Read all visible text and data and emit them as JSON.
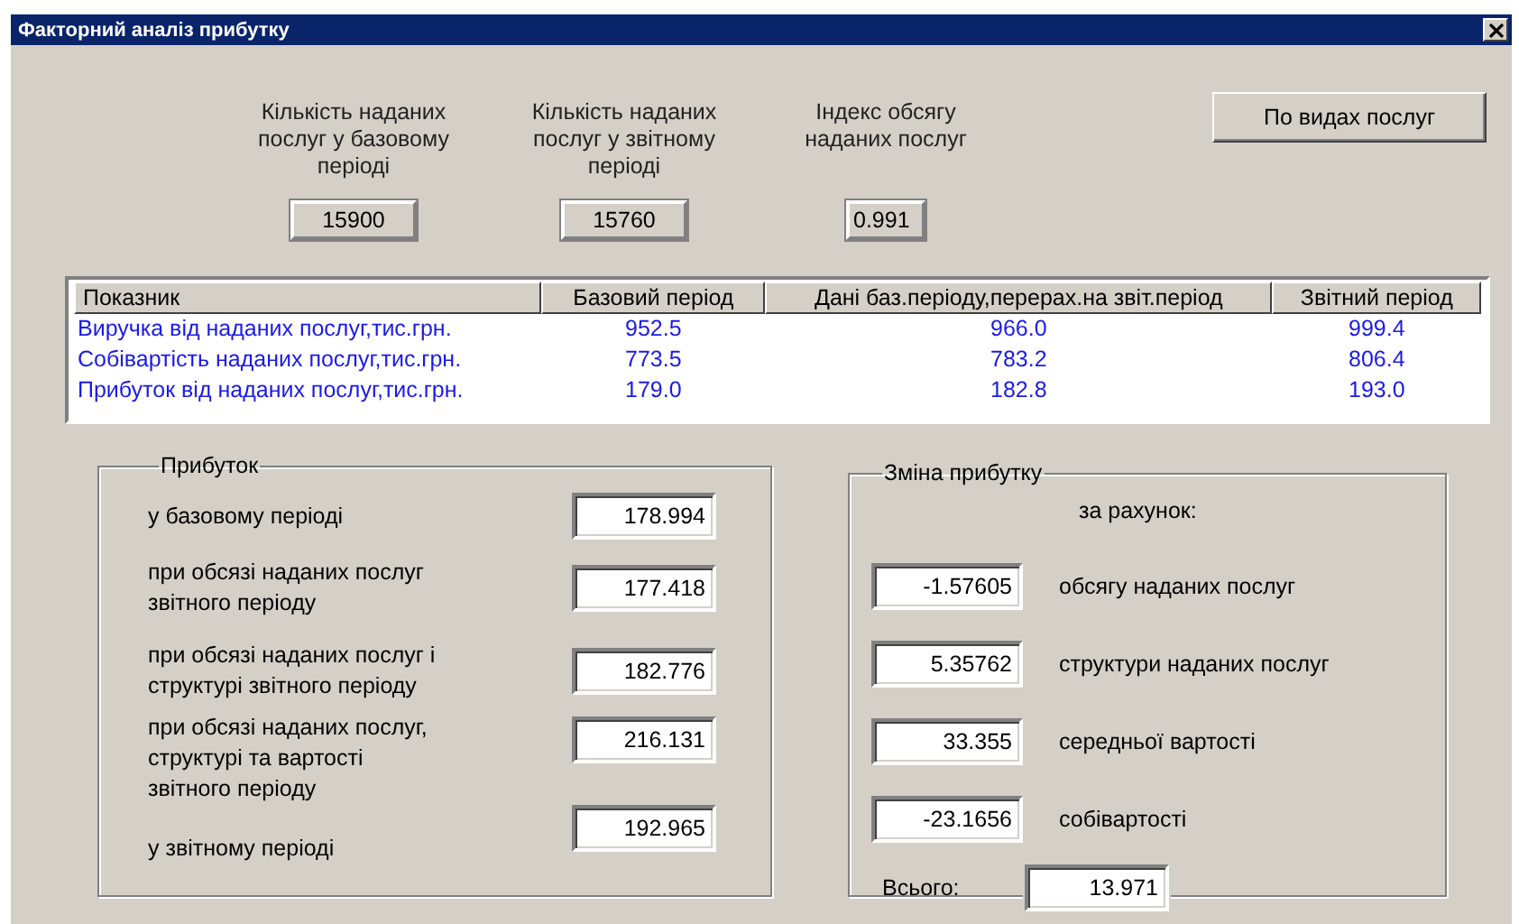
{
  "window": {
    "title": "Факторний аналіз прибутку"
  },
  "summary": [
    {
      "label": "Кількість наданих\nпослуг у базовому\nперіоді",
      "value": "15900"
    },
    {
      "label": "Кількість наданих\nпослуг у звітному\nперіоді",
      "value": "15760"
    },
    {
      "label": "Індекс обсягу\nнаданих послуг",
      "value": "0.991"
    }
  ],
  "button": "По видах послуг",
  "table": {
    "columns": [
      "Показник",
      "Базовий період",
      "Дані баз.періоду,перерах.на звіт.період",
      "Звітний період"
    ],
    "rows": [
      [
        "Виручка від наданих послуг,тис.грн.",
        "952.5",
        "966.0",
        "999.4"
      ],
      [
        "Собівартість наданих послуг,тис.грн.",
        "773.5",
        "783.2",
        "806.4"
      ],
      [
        "Прибуток від наданих послуг,тис.грн.",
        "179.0",
        "182.8",
        "193.0"
      ]
    ]
  },
  "profit": {
    "title": "Прибуток",
    "rows": [
      {
        "label": "у базовому періоді",
        "value": "178.994"
      },
      {
        "label": "при обсязі наданих послуг\nзвітного періоду",
        "value": "177.418"
      },
      {
        "label": "при обсязі наданих послуг і\nструктурі звітного періоду",
        "value": "182.776"
      },
      {
        "label": "при обсязі наданих послуг,\nструктурі та вартості\nзвітного періоду",
        "value": "216.131"
      },
      {
        "label": "у звітному періоді",
        "value": "192.965"
      }
    ]
  },
  "change": {
    "title": "Зміна прибутку",
    "caption": "за рахунок:",
    "rows": [
      {
        "value": "-1.57605",
        "label": "обсягу наданих послуг"
      },
      {
        "value": "5.35762",
        "label": "структури наданих послуг"
      },
      {
        "value": "33.355",
        "label": "середньої вартості"
      },
      {
        "value": "-23.1656",
        "label": "собівартості"
      }
    ],
    "total": {
      "label": "Всього:",
      "value": "13.971"
    }
  }
}
